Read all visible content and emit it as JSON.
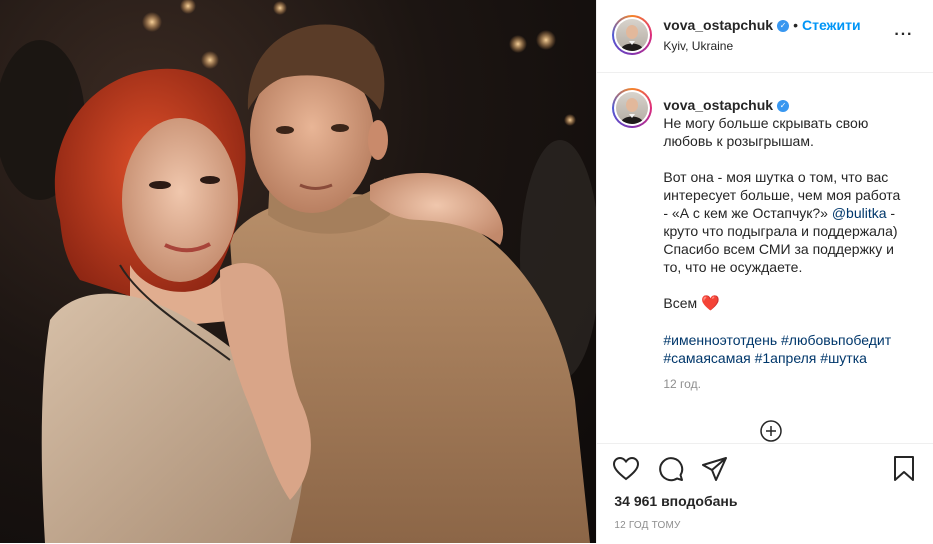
{
  "post": {
    "author": {
      "username": "vova_ostapchuk",
      "verified_mark": "✓",
      "location": "Kyiv, Ukraine"
    },
    "header": {
      "dot": "•",
      "follow_label": "Стежити",
      "more_label": "···"
    },
    "caption": {
      "username": "vova_ostapchuk",
      "lines": [
        "Не могу больше скрывать свою",
        "любовь к розыгрышам."
      ],
      "paragraph2": {
        "line1": "Вот она - моя шутка о том, что вас",
        "line2": "интересует больше, чем моя работа",
        "line3_before_mention": "- «А с кем же Остапчук?» ",
        "mention": "@bulitka",
        "line3_after_mention": " -",
        "line4": "круто что подыграла и поддержала)",
        "line5": "Спасибо всем СМИ за поддержку и",
        "line6": "то, что не осуждаете."
      },
      "paragraph3": {
        "text": "Всем ",
        "emoji": "❤️"
      },
      "hashtags_line1": "#именноэтотдень #любовьпобедит",
      "hashtags_line2": "#самаясамая #1апреля #шутка",
      "time_ago": "12 год."
    },
    "stats": {
      "likes": "34 961 вподобань",
      "posted": "12 ГОД ТОМУ"
    },
    "icons": {
      "like": "heart-icon",
      "comment": "comment-icon",
      "share": "share-icon",
      "save": "bookmark-icon",
      "load_more": "plus-circle-icon",
      "more": "more-options-icon"
    },
    "colors": {
      "follow": "#0095f6",
      "verified": "#3897f0",
      "link": "#00376b",
      "secondary_text": "#8e8e8e"
    }
  }
}
